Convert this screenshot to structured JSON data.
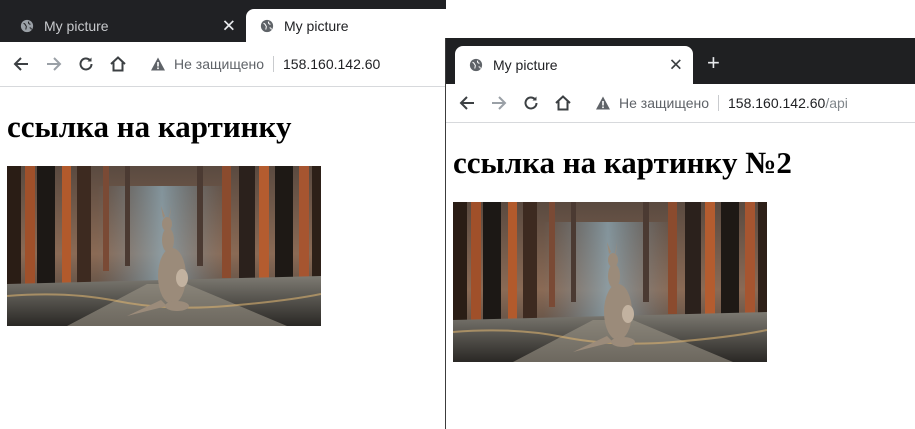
{
  "windows": [
    {
      "tabs": [
        {
          "title": "My picture",
          "active": false
        },
        {
          "title": "My picture",
          "active": true
        }
      ],
      "address": {
        "security_text": "Не защищено",
        "host": "158.160.142.60",
        "path": ""
      },
      "page": {
        "heading": "ссылка на картинку",
        "image_alt": "kangaroo in burnt forest"
      }
    },
    {
      "tabs": [
        {
          "title": "My picture",
          "active": true
        }
      ],
      "address": {
        "security_text": "Не защищено",
        "host": "158.160.142.60",
        "path": "/api"
      },
      "page": {
        "heading": "ссылка на картинку №2",
        "image_alt": "kangaroo in burnt forest"
      }
    }
  ],
  "icons": {
    "globe": "globe-icon",
    "close": "close-icon",
    "new_tab": "plus-icon",
    "back": "back-arrow-icon",
    "forward": "forward-arrow-icon",
    "reload": "reload-icon",
    "home": "home-icon",
    "warning": "warning-icon"
  },
  "glyphs": {
    "close": "✕",
    "new_tab": "+"
  },
  "colors": {
    "tab_bar": "#202124",
    "text_secondary": "#5f6368",
    "url_path": "#80868b"
  }
}
